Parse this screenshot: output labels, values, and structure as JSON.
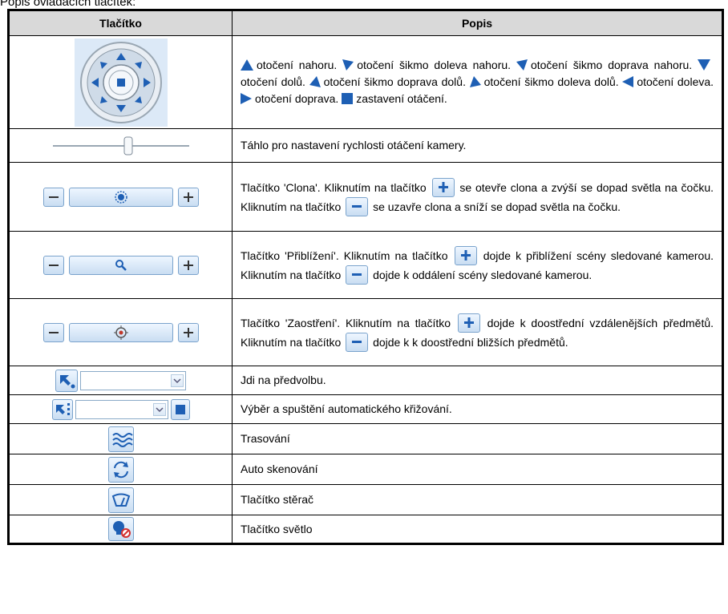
{
  "caption": "Popis ovládacích tlačítek:",
  "headers": {
    "col1": "Tlačítko",
    "col2": "Popis"
  },
  "colors": {
    "accent": "#1565c0",
    "header_bg": "#d9d9d9",
    "button_fill": "#c9ddf2"
  },
  "rows": {
    "ptz": {
      "icon": "ptz-direction-pad",
      "t1": "otočení nahoru.",
      "t2": "otočení šikmo doleva nahoru.",
      "t3": "otočení šikmo doprava nahoru.",
      "t4": "otočení dolů.",
      "t5": "otočení šikmo doprava dolů.",
      "t6": "otočení šikmo doleva dolů.",
      "t7": "otočení doleva.",
      "t8": "otočení doprava.",
      "t9": "zastavení otáčení."
    },
    "speed": {
      "icon": "speed-slider",
      "text": "Táhlo pro nastavení rychlosti otáčení kamery."
    },
    "iris": {
      "icon": "iris-icon",
      "a": "Tlačítko 'Clona'. Kliknutím na tlačítko",
      "b": "se otevře clona a zvýší se dopad světla na čočku. Kliknutím na tlačítko",
      "c": "se uzavře clona a sníží se dopad světla na čočku."
    },
    "zoom": {
      "icon": "zoom-icon",
      "a": "Tlačítko 'Přiblížení'. Kliknutím na tlačítko",
      "b": "dojde k přiblížení scény sledované kamerou. Kliknutím na tlačítko",
      "c": "dojde k oddálení scény sledované kamerou."
    },
    "focus": {
      "icon": "focus-icon",
      "a": "Tlačítko 'Zaostření'. Kliknutím na tlačítko",
      "b": "dojde k doostřední vzdálenějších předmětů. Kliknutím na tlačítko",
      "c": "dojde k k doostřední bližších předmětů."
    },
    "preset": {
      "icon": "preset-goto-icon",
      "text": "Jdi na předvolbu."
    },
    "patrol": {
      "icon": "patrol-icon",
      "text": "Výběr a spuštění automatického křižování."
    },
    "trace": {
      "icon": "trace-wave-icon",
      "text": "Trasování"
    },
    "scan": {
      "icon": "auto-scan-icon",
      "text": "Auto skenování"
    },
    "wiper": {
      "icon": "wiper-icon",
      "text": "Tlačítko stěrač"
    },
    "light": {
      "icon": "light-off-icon",
      "text": "Tlačítko světlo"
    }
  }
}
